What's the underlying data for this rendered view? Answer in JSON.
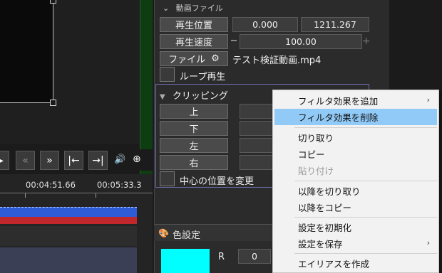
{
  "preview": {},
  "timeline": {
    "time_1": "00:04:51.66",
    "time_2": "00:05:33.3"
  },
  "media_section": {
    "header": "動画ファイル",
    "position_label": "再生位置",
    "position_value": "0.000",
    "position_end": "1211.267",
    "speed_label": "再生速度",
    "speed_value": "100.00",
    "file_label": "ファイル",
    "file_name": "テスト検証動画.mp4",
    "loop_label": "ループ再生"
  },
  "clipping": {
    "header": "クリッピング",
    "top": "上",
    "bottom": "下",
    "left": "左",
    "right": "右",
    "center_label": "中心の位置を変更"
  },
  "color_section": {
    "header": "色設定",
    "r_label": "R",
    "r_value": "0",
    "swatch_color": "#00ffff"
  },
  "context_menu": {
    "items": [
      {
        "label": "フィルタ効果を追加",
        "submenu": true
      },
      {
        "label": "フィルタ効果を削除",
        "highlighted": true
      },
      {
        "label": "切り取り"
      },
      {
        "label": "コピー"
      },
      {
        "label": "貼り付け",
        "disabled": true
      },
      {
        "label": "以降を切り取り"
      },
      {
        "label": "以降をコピー"
      },
      {
        "label": "設定を初期化"
      },
      {
        "label": "設定を保存",
        "submenu": true
      },
      {
        "label": "エイリアスを作成"
      }
    ]
  }
}
